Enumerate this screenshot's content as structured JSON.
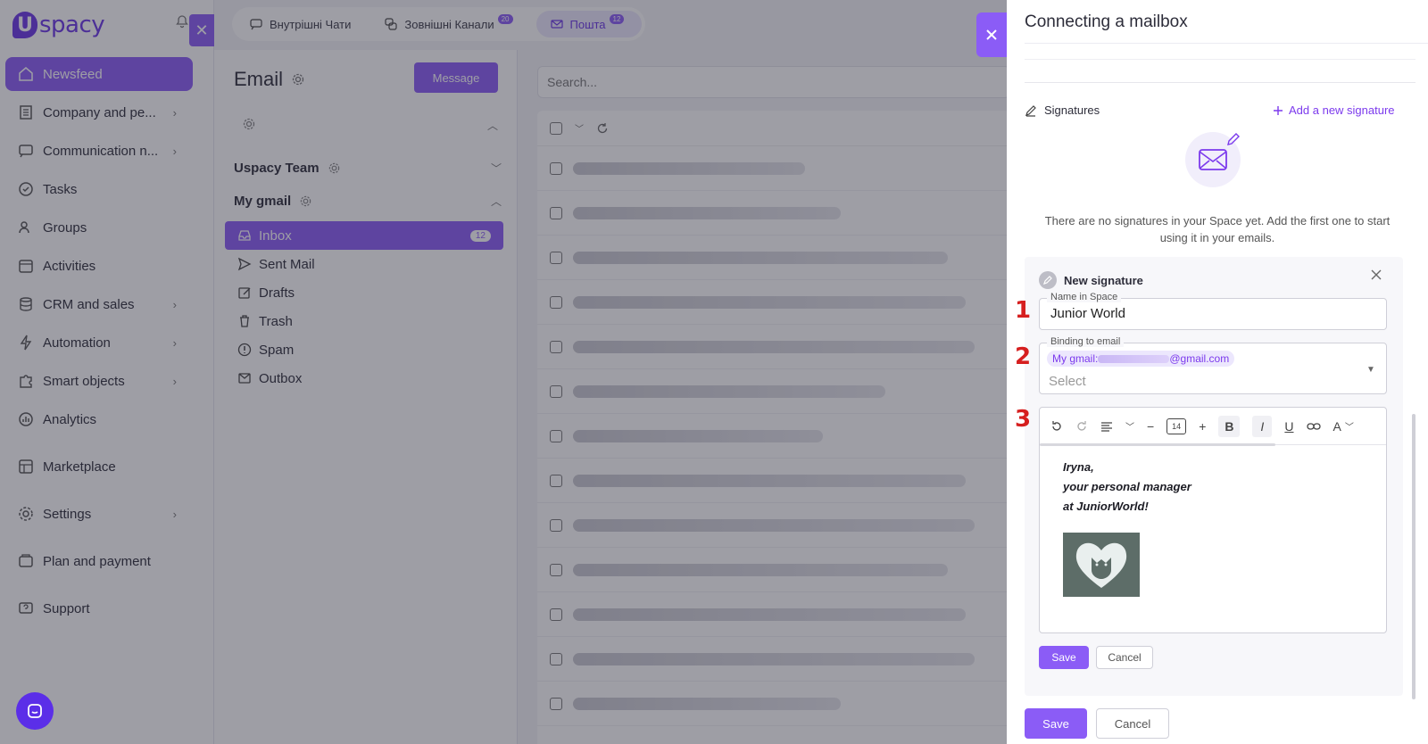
{
  "sidebar": {
    "logo_text": "spacy",
    "logo_letter": "U",
    "items": [
      {
        "label": "Newsfeed",
        "icon": "home-icon",
        "active": true,
        "chevron": false
      },
      {
        "label": "Company and pe...",
        "icon": "building-icon",
        "chevron": true
      },
      {
        "label": "Communication n...",
        "icon": "chat-icon",
        "chevron": true
      },
      {
        "label": "Tasks",
        "icon": "check-circle-icon",
        "chevron": false
      },
      {
        "label": "Groups",
        "icon": "users-icon",
        "chevron": false
      },
      {
        "label": "Activities",
        "icon": "calendar-icon",
        "chevron": false
      },
      {
        "label": "CRM and sales",
        "icon": "database-icon",
        "chevron": true
      },
      {
        "label": "Automation",
        "icon": "bolt-icon",
        "chevron": true
      },
      {
        "label": "Smart objects",
        "icon": "puzzle-icon",
        "chevron": true
      },
      {
        "label": "Analytics",
        "icon": "chart-icon",
        "chevron": false
      },
      {
        "label": "Marketplace",
        "icon": "store-icon",
        "chevron": false
      },
      {
        "label": "Settings",
        "icon": "gear-icon",
        "chevron": true
      },
      {
        "label": "Plan and payment",
        "icon": "wallet-icon",
        "chevron": false
      },
      {
        "label": "Support",
        "icon": "help-icon",
        "chevron": false
      }
    ]
  },
  "topbar": {
    "tabs": [
      {
        "label": "Внутрішні Чати",
        "badge": ""
      },
      {
        "label": "Зовнішні Канали",
        "badge": "20"
      },
      {
        "label": "Пошта",
        "badge": "12"
      }
    ]
  },
  "mail": {
    "title": "Email",
    "message_button": "Message",
    "groups": {
      "team": "Uspacy Team",
      "gmail": "My gmail"
    },
    "folders": [
      {
        "label": "Inbox",
        "count": "12",
        "icon": "inbox-icon"
      },
      {
        "label": "Sent Mail",
        "count": "",
        "icon": "send-icon"
      },
      {
        "label": "Drafts",
        "count": "",
        "icon": "edit-icon"
      },
      {
        "label": "Trash",
        "count": "",
        "icon": "trash-icon"
      },
      {
        "label": "Spam",
        "count": "",
        "icon": "alert-icon"
      },
      {
        "label": "Outbox",
        "count": "",
        "icon": "outbox-icon"
      }
    ],
    "search_placeholder": "Search..."
  },
  "panel": {
    "title": "Connecting a mailbox",
    "signatures_heading": "Signatures",
    "add_signature": "Add a new signature",
    "empty_text": "There are no signatures in your Space yet. Add the first one to start using it in your emails.",
    "new_signature": {
      "heading": "New signature",
      "name_label": "Name in Space",
      "name_value": "Junior World",
      "binding_label": "Binding to email",
      "chip_prefix": "My gmail:",
      "chip_suffix": "@gmail.com",
      "select_placeholder": "Select",
      "toolbar": {
        "font_size": "14",
        "bold": "B",
        "italic": "I",
        "underline": "U",
        "text_color": "A"
      },
      "body_lines": [
        "Iryna,",
        "your personal manager",
        "at JuniorWorld!"
      ],
      "save": "Save",
      "cancel": "Cancel"
    },
    "save": "Save",
    "cancel": "Cancel",
    "steps": [
      "1",
      "2",
      "3"
    ]
  },
  "colors": {
    "accent": "#8b5cf6",
    "step_marker": "#d61f1f"
  }
}
